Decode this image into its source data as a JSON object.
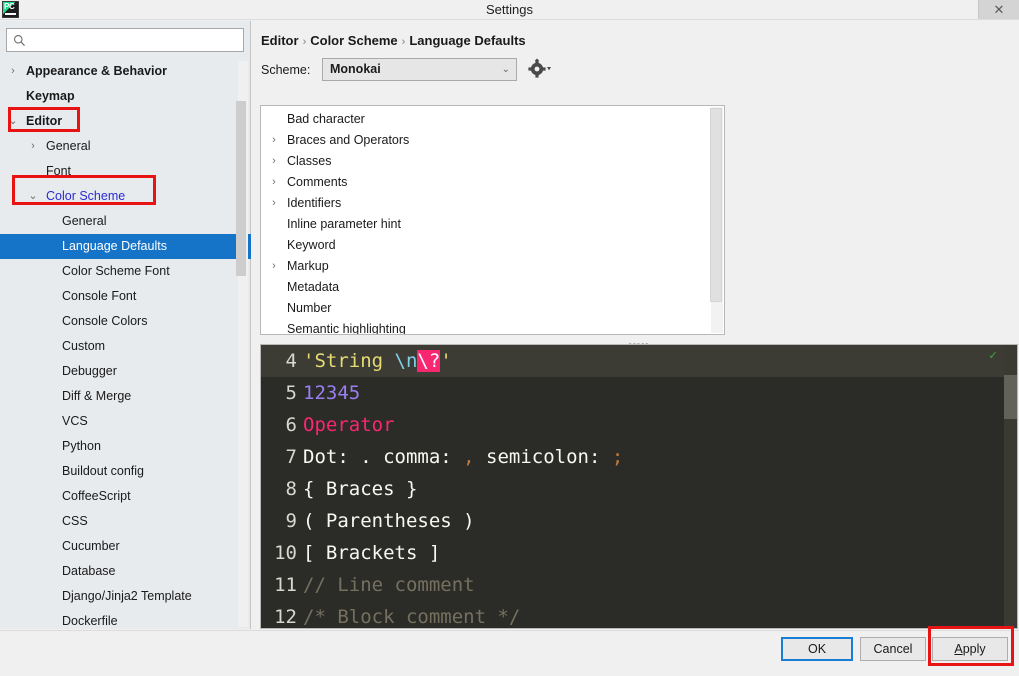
{
  "window": {
    "title": "Settings",
    "app_icon": "pycharm-icon",
    "close_label": "✕"
  },
  "sidebar": {
    "search": {
      "value": "",
      "placeholder": "",
      "icon": "search-icon"
    },
    "items": [
      {
        "label": "Appearance & Behavior",
        "arrow": "›",
        "indent": 26,
        "bold": true,
        "selected": false,
        "link": false
      },
      {
        "label": "Keymap",
        "arrow": "",
        "indent": 26,
        "bold": true,
        "selected": false,
        "link": false
      },
      {
        "label": "Editor",
        "arrow": "⌄",
        "indent": 26,
        "bold": true,
        "selected": false,
        "link": false
      },
      {
        "label": "General",
        "arrow": "›",
        "indent": 46,
        "bold": false,
        "selected": false,
        "link": false
      },
      {
        "label": "Font",
        "arrow": "",
        "indent": 46,
        "bold": false,
        "selected": false,
        "link": false
      },
      {
        "label": "Color Scheme",
        "arrow": "⌄",
        "indent": 46,
        "bold": false,
        "selected": false,
        "link": true
      },
      {
        "label": "General",
        "arrow": "",
        "indent": 62,
        "bold": false,
        "selected": false,
        "link": false
      },
      {
        "label": "Language Defaults",
        "arrow": "",
        "indent": 62,
        "bold": false,
        "selected": true,
        "link": false
      },
      {
        "label": "Color Scheme Font",
        "arrow": "",
        "indent": 62,
        "bold": false,
        "selected": false,
        "link": false
      },
      {
        "label": "Console Font",
        "arrow": "",
        "indent": 62,
        "bold": false,
        "selected": false,
        "link": false
      },
      {
        "label": "Console Colors",
        "arrow": "",
        "indent": 62,
        "bold": false,
        "selected": false,
        "link": false
      },
      {
        "label": "Custom",
        "arrow": "",
        "indent": 62,
        "bold": false,
        "selected": false,
        "link": false
      },
      {
        "label": "Debugger",
        "arrow": "",
        "indent": 62,
        "bold": false,
        "selected": false,
        "link": false
      },
      {
        "label": "Diff & Merge",
        "arrow": "",
        "indent": 62,
        "bold": false,
        "selected": false,
        "link": false
      },
      {
        "label": "VCS",
        "arrow": "",
        "indent": 62,
        "bold": false,
        "selected": false,
        "link": false
      },
      {
        "label": "Python",
        "arrow": "",
        "indent": 62,
        "bold": false,
        "selected": false,
        "link": false
      },
      {
        "label": "Buildout config",
        "arrow": "",
        "indent": 62,
        "bold": false,
        "selected": false,
        "link": false
      },
      {
        "label": "CoffeeScript",
        "arrow": "",
        "indent": 62,
        "bold": false,
        "selected": false,
        "link": false
      },
      {
        "label": "CSS",
        "arrow": "",
        "indent": 62,
        "bold": false,
        "selected": false,
        "link": false
      },
      {
        "label": "Cucumber",
        "arrow": "",
        "indent": 62,
        "bold": false,
        "selected": false,
        "link": false
      },
      {
        "label": "Database",
        "arrow": "",
        "indent": 62,
        "bold": false,
        "selected": false,
        "link": false
      },
      {
        "label": "Django/Jinja2 Template",
        "arrow": "",
        "indent": 62,
        "bold": false,
        "selected": false,
        "link": false
      },
      {
        "label": "Dockerfile",
        "arrow": "",
        "indent": 62,
        "bold": false,
        "selected": false,
        "link": false
      }
    ]
  },
  "help": {
    "label": "?"
  },
  "main": {
    "breadcrumb": {
      "parts": [
        "Editor",
        "Color Scheme",
        "Language Defaults"
      ],
      "separator": "›"
    },
    "scheme": {
      "label": "Scheme:",
      "value": "Monokai",
      "chevron": "⌄",
      "gear_icon": "gear-icon"
    },
    "color_tree": {
      "items": [
        {
          "label": "Bad character",
          "arrow": ""
        },
        {
          "label": "Braces and Operators",
          "arrow": "›"
        },
        {
          "label": "Classes",
          "arrow": "›"
        },
        {
          "label": "Comments",
          "arrow": "›"
        },
        {
          "label": "Identifiers",
          "arrow": "›"
        },
        {
          "label": "Inline parameter hint",
          "arrow": ""
        },
        {
          "label": "Keyword",
          "arrow": ""
        },
        {
          "label": "Markup",
          "arrow": "›"
        },
        {
          "label": "Metadata",
          "arrow": ""
        },
        {
          "label": "Number",
          "arrow": ""
        },
        {
          "label": "Semantic highlighting",
          "arrow": ""
        }
      ]
    },
    "preview": {
      "check_icon": "✓",
      "lines": [
        {
          "num": "4",
          "caret": true,
          "tokens": [
            {
              "t": "'",
              "c": "quote"
            },
            {
              "t": "String ",
              "c": "string"
            },
            {
              "t": "\\n",
              "c": "escape"
            },
            {
              "t": "\\?",
              "c": "invalid"
            },
            {
              "t": "'",
              "c": "quote"
            }
          ]
        },
        {
          "num": "5",
          "caret": false,
          "tokens": [
            {
              "t": "12345",
              "c": "number"
            }
          ]
        },
        {
          "num": "6",
          "caret": false,
          "tokens": [
            {
              "t": "Operator",
              "c": "operator"
            }
          ]
        },
        {
          "num": "7",
          "caret": false,
          "tokens": [
            {
              "t": "Dot: . comma: ",
              "c": "plain"
            },
            {
              "t": ",",
              "c": "comma"
            },
            {
              "t": " semicolon: ",
              "c": "plain"
            },
            {
              "t": ";",
              "c": "comma"
            }
          ]
        },
        {
          "num": "8",
          "caret": false,
          "tokens": [
            {
              "t": "{ Braces }",
              "c": "plain"
            }
          ]
        },
        {
          "num": "9",
          "caret": false,
          "tokens": [
            {
              "t": "( Parentheses )",
              "c": "plain"
            }
          ]
        },
        {
          "num": "10",
          "caret": false,
          "tokens": [
            {
              "t": "[ Brackets ]",
              "c": "plain"
            }
          ]
        },
        {
          "num": "11",
          "caret": false,
          "tokens": [
            {
              "t": "// Line comment",
              "c": "comment"
            }
          ]
        },
        {
          "num": "12",
          "caret": false,
          "tokens": [
            {
              "t": "/* Block comment */",
              "c": "comment"
            }
          ]
        }
      ]
    }
  },
  "buttons": {
    "ok": "OK",
    "cancel": "Cancel",
    "apply_accel": "A",
    "apply_rest": "pply"
  },
  "annotations": {
    "color": "#e81414",
    "boxes": [
      "editor-sidebar-item",
      "color-scheme-sidebar-item",
      "apply-button"
    ]
  }
}
